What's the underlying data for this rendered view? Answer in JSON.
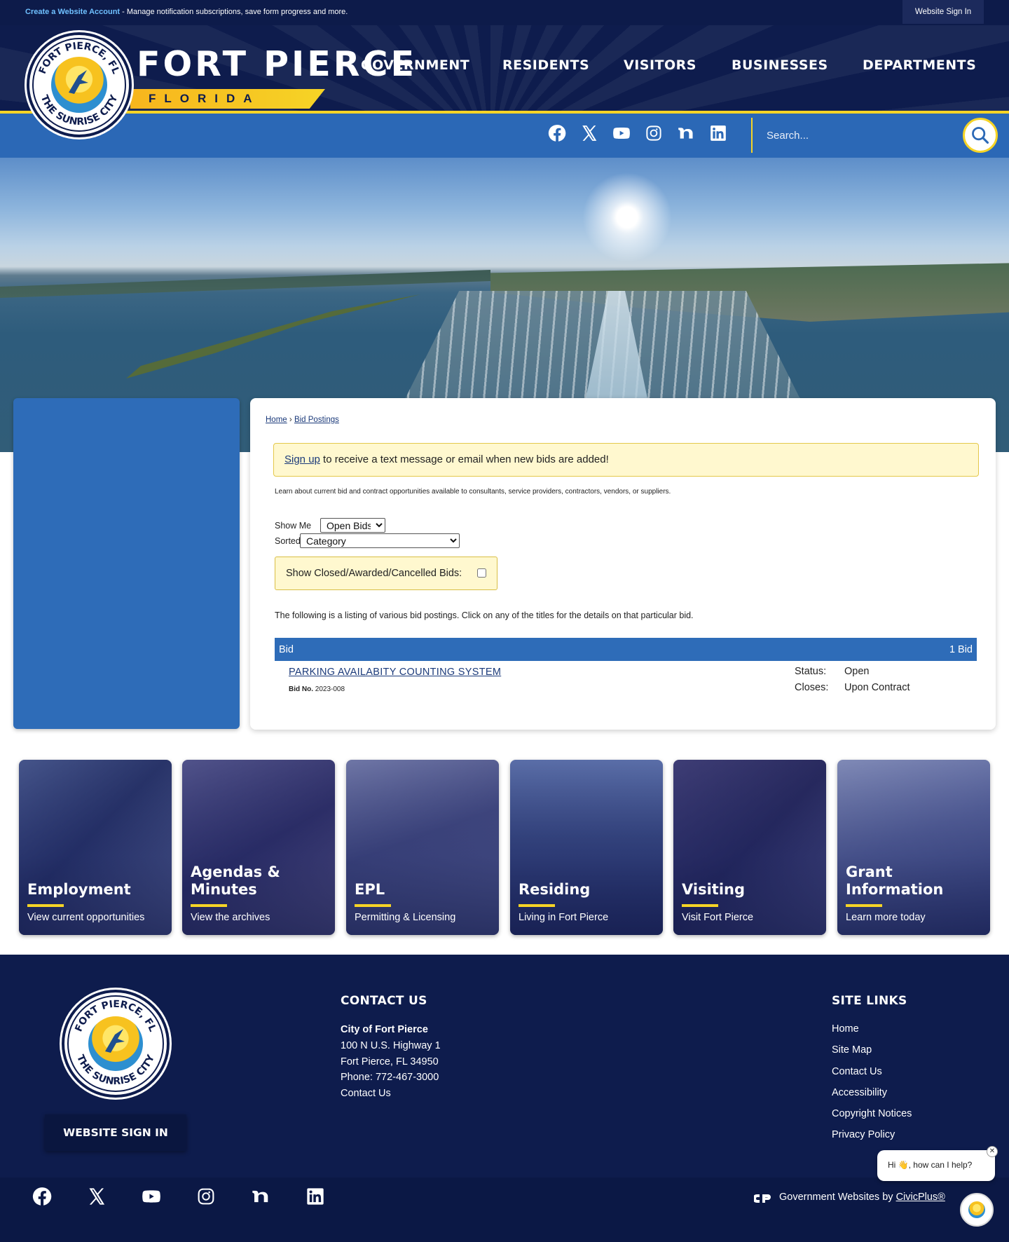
{
  "topbar": {
    "create_link": "Create a Website Account",
    "create_text": " - Manage notification subscriptions, save form progress and more.",
    "signin": "Website Sign In"
  },
  "brand": {
    "title": "FORT PIERCE",
    "subtitle": "FLORIDA",
    "seal_top": "FORT PIERCE, FL",
    "seal_bottom": "THE SUNRISE CITY"
  },
  "nav": [
    "GOVERNMENT",
    "RESIDENTS",
    "VISITORS",
    "BUSINESSES",
    "DEPARTMENTS"
  ],
  "social": [
    "facebook-icon",
    "x-icon",
    "youtube-icon",
    "instagram-icon",
    "nextdoor-icon",
    "linkedin-icon"
  ],
  "search": {
    "placeholder": "Search..."
  },
  "breadcrumb": {
    "home": "Home",
    "separator": "›",
    "current": "Bid Postings"
  },
  "alert": {
    "link": "Sign up",
    "text": " to receive a text message or email when new bids are added!"
  },
  "intro": "Learn about current bid and contract opportunities available to consultants, service providers, contractors, vendors, or suppliers.",
  "filters": {
    "show_me_label": "Show Me",
    "show_me_value": "Open Bids",
    "sorted_by_label": "Sorted By",
    "sorted_by_value": "Category",
    "closed_label": "Show Closed/Awarded/Cancelled Bids:"
  },
  "listing_text": "The following is a listing of various bid postings. Click on any of the titles for the details on that particular bid.",
  "bids": {
    "header_left": "Bid",
    "header_right": "1 Bid",
    "items": [
      {
        "title": "PARKING AVAILABITY COUNTING SYSTEM",
        "bid_no_label": "Bid No.",
        "bid_no": "2023-008",
        "status_label": "Status:",
        "status": "Open",
        "closes_label": "Closes:",
        "closes": "Upon Contract"
      }
    ]
  },
  "tiles": [
    {
      "title": "Employment",
      "subtitle": "View current opportunities",
      "color": "#3a4a7a"
    },
    {
      "title": "Agendas & Minutes",
      "subtitle": "View the archives",
      "color": "#4a4470"
    },
    {
      "title": "EPL",
      "subtitle": "Permitting & Licensing",
      "color": "#5a5a86"
    },
    {
      "title": "Residing",
      "subtitle": "Living in Fort Pierce",
      "color": "#3b4f7d"
    },
    {
      "title": "Visiting",
      "subtitle": "Visit Fort Pierce",
      "color": "#443d6a"
    },
    {
      "title": "Grant Information",
      "subtitle": "Learn more today",
      "color": "#5f6b98"
    }
  ],
  "footer": {
    "signin": "WEBSITE SIGN IN",
    "contact_heading": "CONTACT US",
    "contact_name": "City of Fort Pierce",
    "contact_lines": [
      "100 N U.S. Highway 1",
      "Fort Pierce, FL 34950",
      "Phone: 772-467-3000",
      "Contact Us"
    ],
    "links_heading": "SITE LINKS",
    "links": [
      "Home",
      "Site Map",
      "Contact Us",
      "Accessibility",
      "Copyright Notices",
      "Privacy Policy"
    ],
    "credit_text": "Government Websites by ",
    "credit_link": "CivicPlus®"
  },
  "chat": {
    "message": "Hi 👋, how can I help?",
    "close": "✕"
  },
  "colors": {
    "navy": "#0e1c4d",
    "blue": "#2e6cb8",
    "yellow": "#f6d426",
    "alert_bg": "#fff8cf"
  }
}
